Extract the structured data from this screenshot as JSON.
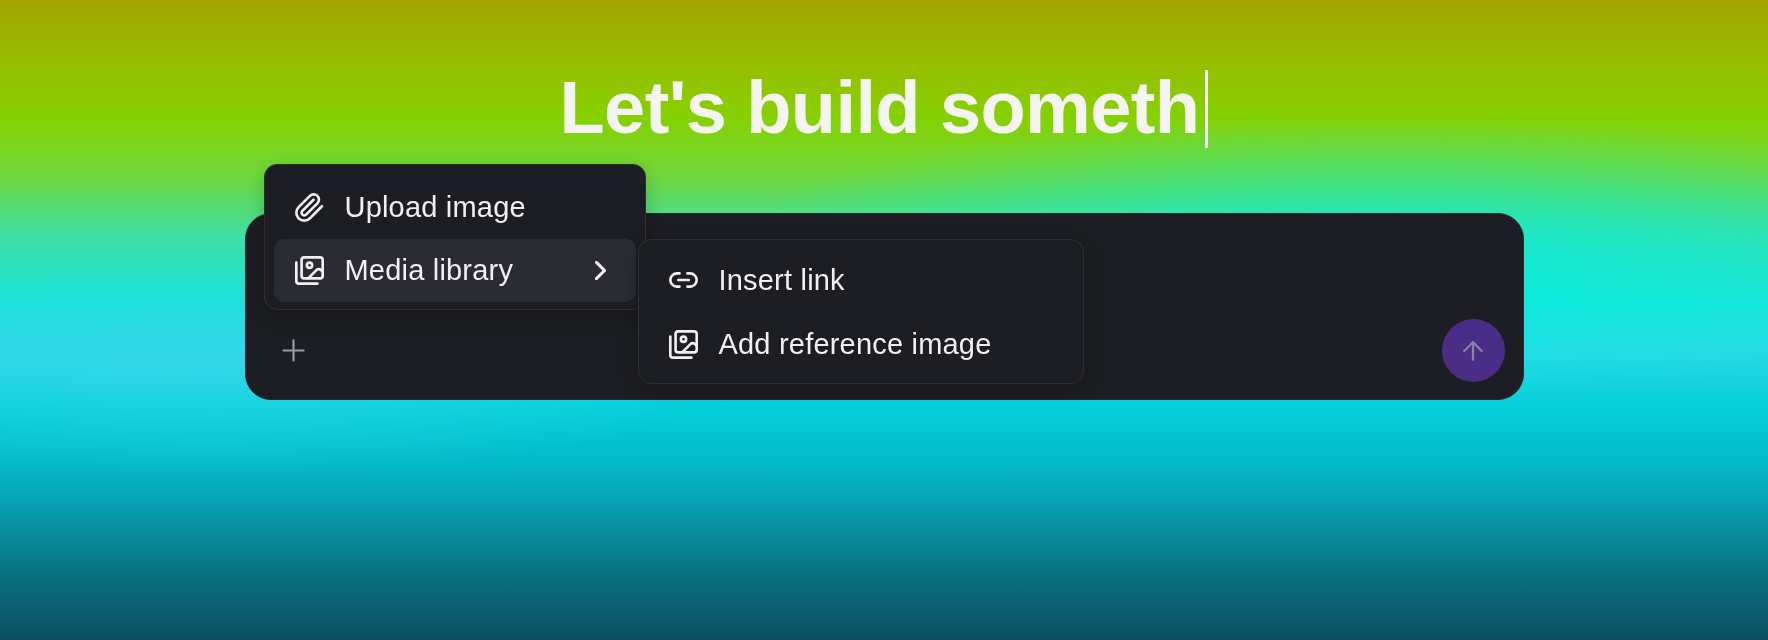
{
  "heading": {
    "text": "Let's build someth",
    "caret": true
  },
  "prompt": {
    "send_button": {
      "disabled": true
    }
  },
  "menu": {
    "items": [
      {
        "kind": "action",
        "label": "Upload image",
        "selected": false
      },
      {
        "kind": "submenu",
        "label": "Media library",
        "selected": true
      }
    ]
  },
  "submenu": {
    "items": [
      {
        "kind": "action",
        "label": "Insert link",
        "selected": false
      },
      {
        "kind": "action",
        "label": "Add reference image",
        "selected": false
      }
    ]
  }
}
